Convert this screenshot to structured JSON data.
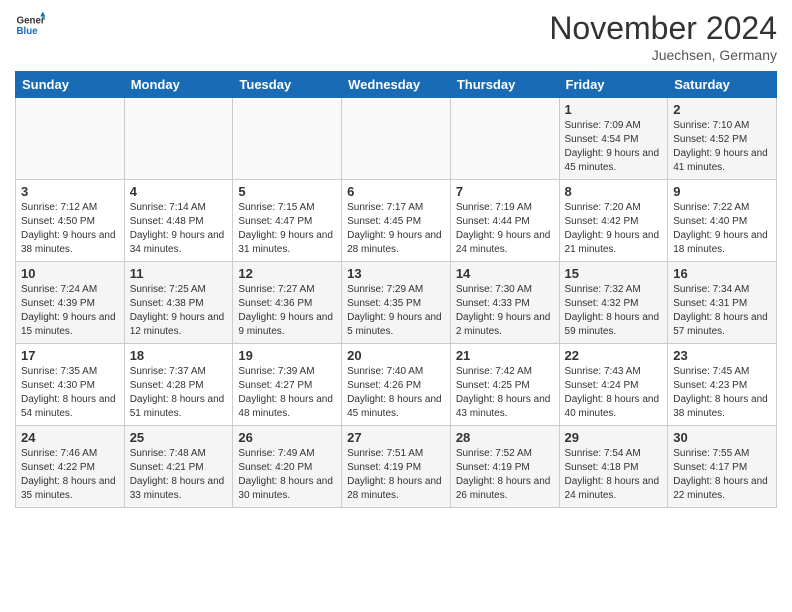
{
  "header": {
    "logo_line1": "General",
    "logo_line2": "Blue",
    "month_title": "November 2024",
    "location": "Juechsen, Germany"
  },
  "days_of_week": [
    "Sunday",
    "Monday",
    "Tuesday",
    "Wednesday",
    "Thursday",
    "Friday",
    "Saturday"
  ],
  "weeks": [
    [
      {
        "day": "",
        "info": ""
      },
      {
        "day": "",
        "info": ""
      },
      {
        "day": "",
        "info": ""
      },
      {
        "day": "",
        "info": ""
      },
      {
        "day": "",
        "info": ""
      },
      {
        "day": "1",
        "info": "Sunrise: 7:09 AM\nSunset: 4:54 PM\nDaylight: 9 hours and 45 minutes."
      },
      {
        "day": "2",
        "info": "Sunrise: 7:10 AM\nSunset: 4:52 PM\nDaylight: 9 hours and 41 minutes."
      }
    ],
    [
      {
        "day": "3",
        "info": "Sunrise: 7:12 AM\nSunset: 4:50 PM\nDaylight: 9 hours and 38 minutes."
      },
      {
        "day": "4",
        "info": "Sunrise: 7:14 AM\nSunset: 4:48 PM\nDaylight: 9 hours and 34 minutes."
      },
      {
        "day": "5",
        "info": "Sunrise: 7:15 AM\nSunset: 4:47 PM\nDaylight: 9 hours and 31 minutes."
      },
      {
        "day": "6",
        "info": "Sunrise: 7:17 AM\nSunset: 4:45 PM\nDaylight: 9 hours and 28 minutes."
      },
      {
        "day": "7",
        "info": "Sunrise: 7:19 AM\nSunset: 4:44 PM\nDaylight: 9 hours and 24 minutes."
      },
      {
        "day": "8",
        "info": "Sunrise: 7:20 AM\nSunset: 4:42 PM\nDaylight: 9 hours and 21 minutes."
      },
      {
        "day": "9",
        "info": "Sunrise: 7:22 AM\nSunset: 4:40 PM\nDaylight: 9 hours and 18 minutes."
      }
    ],
    [
      {
        "day": "10",
        "info": "Sunrise: 7:24 AM\nSunset: 4:39 PM\nDaylight: 9 hours and 15 minutes."
      },
      {
        "day": "11",
        "info": "Sunrise: 7:25 AM\nSunset: 4:38 PM\nDaylight: 9 hours and 12 minutes."
      },
      {
        "day": "12",
        "info": "Sunrise: 7:27 AM\nSunset: 4:36 PM\nDaylight: 9 hours and 9 minutes."
      },
      {
        "day": "13",
        "info": "Sunrise: 7:29 AM\nSunset: 4:35 PM\nDaylight: 9 hours and 5 minutes."
      },
      {
        "day": "14",
        "info": "Sunrise: 7:30 AM\nSunset: 4:33 PM\nDaylight: 9 hours and 2 minutes."
      },
      {
        "day": "15",
        "info": "Sunrise: 7:32 AM\nSunset: 4:32 PM\nDaylight: 8 hours and 59 minutes."
      },
      {
        "day": "16",
        "info": "Sunrise: 7:34 AM\nSunset: 4:31 PM\nDaylight: 8 hours and 57 minutes."
      }
    ],
    [
      {
        "day": "17",
        "info": "Sunrise: 7:35 AM\nSunset: 4:30 PM\nDaylight: 8 hours and 54 minutes."
      },
      {
        "day": "18",
        "info": "Sunrise: 7:37 AM\nSunset: 4:28 PM\nDaylight: 8 hours and 51 minutes."
      },
      {
        "day": "19",
        "info": "Sunrise: 7:39 AM\nSunset: 4:27 PM\nDaylight: 8 hours and 48 minutes."
      },
      {
        "day": "20",
        "info": "Sunrise: 7:40 AM\nSunset: 4:26 PM\nDaylight: 8 hours and 45 minutes."
      },
      {
        "day": "21",
        "info": "Sunrise: 7:42 AM\nSunset: 4:25 PM\nDaylight: 8 hours and 43 minutes."
      },
      {
        "day": "22",
        "info": "Sunrise: 7:43 AM\nSunset: 4:24 PM\nDaylight: 8 hours and 40 minutes."
      },
      {
        "day": "23",
        "info": "Sunrise: 7:45 AM\nSunset: 4:23 PM\nDaylight: 8 hours and 38 minutes."
      }
    ],
    [
      {
        "day": "24",
        "info": "Sunrise: 7:46 AM\nSunset: 4:22 PM\nDaylight: 8 hours and 35 minutes."
      },
      {
        "day": "25",
        "info": "Sunrise: 7:48 AM\nSunset: 4:21 PM\nDaylight: 8 hours and 33 minutes."
      },
      {
        "day": "26",
        "info": "Sunrise: 7:49 AM\nSunset: 4:20 PM\nDaylight: 8 hours and 30 minutes."
      },
      {
        "day": "27",
        "info": "Sunrise: 7:51 AM\nSunset: 4:19 PM\nDaylight: 8 hours and 28 minutes."
      },
      {
        "day": "28",
        "info": "Sunrise: 7:52 AM\nSunset: 4:19 PM\nDaylight: 8 hours and 26 minutes."
      },
      {
        "day": "29",
        "info": "Sunrise: 7:54 AM\nSunset: 4:18 PM\nDaylight: 8 hours and 24 minutes."
      },
      {
        "day": "30",
        "info": "Sunrise: 7:55 AM\nSunset: 4:17 PM\nDaylight: 8 hours and 22 minutes."
      }
    ]
  ]
}
